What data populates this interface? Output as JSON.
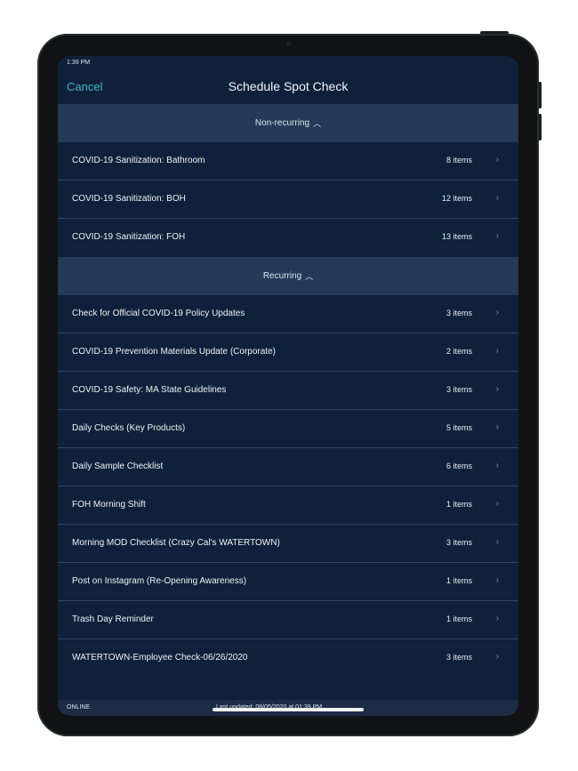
{
  "status": {
    "time": "1:39 PM"
  },
  "nav": {
    "cancel_label": "Cancel",
    "title": "Schedule Spot Check"
  },
  "sections": [
    {
      "header": "Non-recurring",
      "items": [
        {
          "label": "COVID-19 Sanitization: Bathroom",
          "count": "8 items"
        },
        {
          "label": "COVID-19 Sanitization: BOH",
          "count": "12 items"
        },
        {
          "label": "COVID-19 Sanitization: FOH",
          "count": "13 items"
        }
      ]
    },
    {
      "header": "Recurring",
      "items": [
        {
          "label": "Check for Official COVID-19 Policy Updates",
          "count": "3 items"
        },
        {
          "label": "COVID-19 Prevention Materials Update (Corporate)",
          "count": "2 items"
        },
        {
          "label": "COVID-19 Safety: MA State Guidelines",
          "count": "3 items"
        },
        {
          "label": "Daily Checks (Key Products)",
          "count": "5 items"
        },
        {
          "label": "Daily Sample Checklist",
          "count": "6 items"
        },
        {
          "label": "FOH Morning Shift",
          "count": "1 items"
        },
        {
          "label": "Morning MOD Checklist (Crazy Cal's WATERTOWN)",
          "count": "3 items"
        },
        {
          "label": "Post on Instagram (Re-Opening Awareness)",
          "count": "1 items"
        },
        {
          "label": "Trash Day Reminder",
          "count": "1 items"
        },
        {
          "label": "WATERTOWN-Employee Check-06/26/2020",
          "count": "3 items"
        }
      ]
    }
  ],
  "footer": {
    "status": "ONLINE",
    "last_updated": "Last updated: 08/05/2020 at 01:39 PM"
  },
  "icons": {
    "chevron": "chevron-right-icon",
    "caret": "caret-up-icon"
  },
  "colors": {
    "accent": "#3fb4c7",
    "background": "#0f213a",
    "section": "#243a56"
  }
}
